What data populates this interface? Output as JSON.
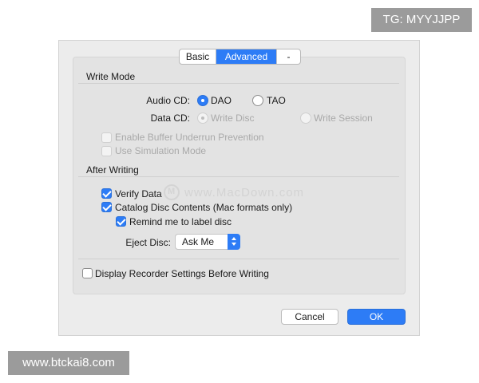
{
  "badges": {
    "tg": "TG: MYYJJPP",
    "site": "www.btckai8.com"
  },
  "tabs": [
    {
      "label": "Basic",
      "selected": false
    },
    {
      "label": "Advanced",
      "selected": true
    },
    {
      "label": "-",
      "selected": false
    }
  ],
  "write_mode": {
    "title": "Write Mode",
    "audio_cd": {
      "label": "Audio CD:",
      "options": [
        "DAO",
        "TAO"
      ],
      "selected": "DAO"
    },
    "data_cd": {
      "label": "Data CD:",
      "options": [
        "Write Disc",
        "Write Session"
      ],
      "selected": "Write Disc",
      "disabled": true
    },
    "buffer_underrun": {
      "label": "Enable Buffer Underrun Prevention",
      "checked": false,
      "disabled": true
    },
    "simulation": {
      "label": "Use Simulation Mode",
      "checked": false,
      "disabled": true
    }
  },
  "after_writing": {
    "title": "After Writing",
    "verify": {
      "label": "Verify Data",
      "checked": true
    },
    "catalog": {
      "label": "Catalog Disc Contents (Mac formats only)",
      "checked": true
    },
    "remind": {
      "label": "Remind me to label disc",
      "checked": true
    },
    "eject": {
      "label": "Eject Disc:",
      "value": "Ask Me"
    }
  },
  "display_settings": {
    "label": "Display Recorder Settings Before Writing",
    "checked": false
  },
  "buttons": {
    "cancel": "Cancel",
    "ok": "OK"
  },
  "watermark": "www.MacDown.com",
  "colors": {
    "accent": "#2d7cf6",
    "dialog_bg": "#ececec",
    "badge_bg": "#9b9b9b"
  }
}
